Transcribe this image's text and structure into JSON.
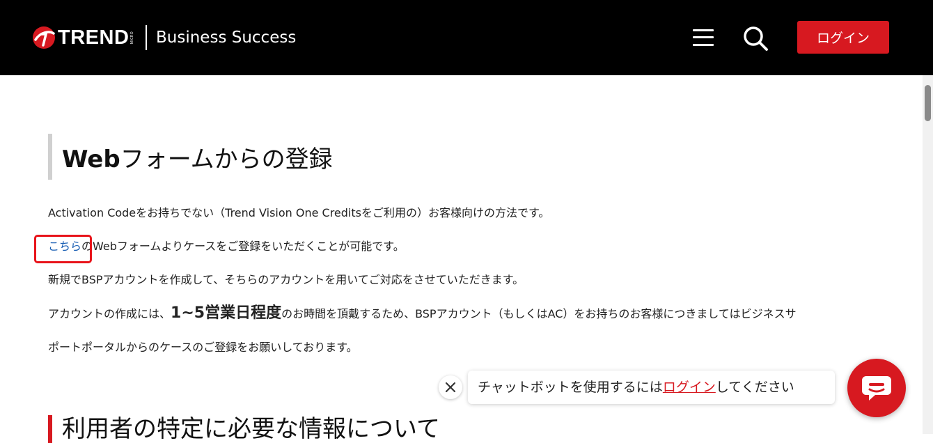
{
  "header": {
    "logo_word": "TREND",
    "logo_micro": "MICRO",
    "title": "Business Success",
    "login_label": "ログイン"
  },
  "section": {
    "heading_bold": "Web",
    "heading_rest": "フォームからの登録",
    "para1": "Activation Codeをお持ちでない（Trend Vision One Creditsをご利用の）お客様向けの方法です。",
    "para2_link": "こちら",
    "para2_rest": "のWebフォームよりケースをご登録をいただくことが可能です。",
    "para3": "新規でBSPアカウントを作成して、そちらのアカウントを用いてご対応をさせていただきます。",
    "para4_pre": "アカウントの作成には、",
    "para4_bold": "1~5営業日程度",
    "para4_post": "のお時間を頂戴するため、BSPアカウント（もしくはAC）をお持ちのお客様につきましてはビジネスサ",
    "para5": "ポートポータルからのケースのご登録をお願いしております。"
  },
  "section2": {
    "heading": "利用者の特定に必要な情報について"
  },
  "chat": {
    "prompt_pre": "チャットボットを使用するには",
    "prompt_link": "ログイン",
    "prompt_post": "してください"
  },
  "colors": {
    "brand_red": "#d71920",
    "header_bg": "#000000",
    "link_blue": "#1a5fb4"
  },
  "icons": [
    "trend-micro-logo-icon",
    "hamburger-menu-icon",
    "search-icon",
    "close-icon",
    "chat-icon"
  ]
}
